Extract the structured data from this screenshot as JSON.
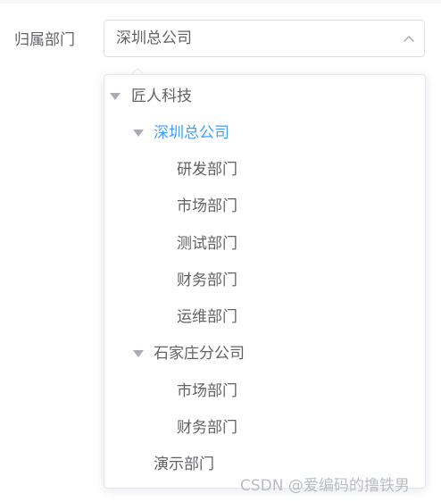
{
  "form": {
    "label": "归属部门",
    "selected_value": "深圳总公司"
  },
  "tree": {
    "root": {
      "label": "匠人科技"
    },
    "shenzhen": {
      "label": "深圳总公司",
      "children": [
        "研发部门",
        "市场部门",
        "测试部门",
        "财务部门",
        "运维部门"
      ]
    },
    "shijiazhuang": {
      "label": "石家庄分公司",
      "children": [
        "市场部门",
        "财务部门"
      ]
    },
    "demo": {
      "label": "演示部门"
    }
  },
  "colors": {
    "selected": "#409eff",
    "text": "#606266",
    "caret": "#a8abb2",
    "border": "#dcdfe6"
  },
  "icons": {
    "select_arrow": "chevron-up-icon",
    "expand": "caret-down-icon"
  },
  "watermark": "CSDN @爱编码的撸铁男"
}
